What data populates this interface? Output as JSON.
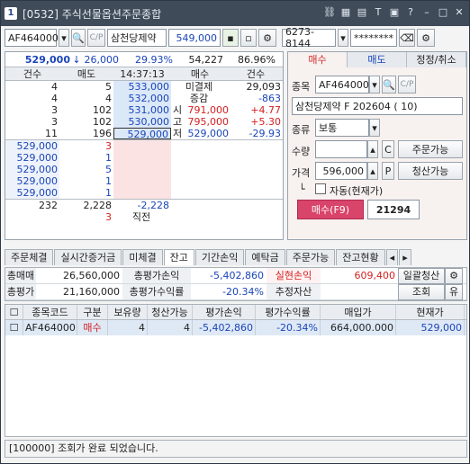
{
  "title": {
    "num": "1",
    "text": "[0532] 주식선물옵션주문종합"
  },
  "titlebar_icons": [
    "chain-icon",
    "grid-icon",
    "table-icon",
    "text-icon",
    "calc-icon",
    "help-icon",
    "minimize-icon",
    "maximize-icon",
    "close-icon"
  ],
  "top": {
    "code": "AF464000",
    "name": "삼천당제약",
    "price": "549,000",
    "account": "6273-8144",
    "password": "********"
  },
  "hoga": {
    "current": "529,000",
    "change": "26,000",
    "rate": "29.93%",
    "volume": "54,227",
    "ratio": "86.96%",
    "head": [
      "건수",
      "매도",
      "14:37:13",
      "매수",
      "건수"
    ],
    "asks": [
      {
        "cnt": "4",
        "qty": "5",
        "price": "533,000",
        "label": "미결제",
        "val": "29,093"
      },
      {
        "cnt": "4",
        "qty": "4",
        "price": "532,000",
        "label": "증감",
        "val": "-863"
      },
      {
        "cnt": "3",
        "qty": "102",
        "price": "531,000",
        "label": "시",
        "val": "791,000",
        "val2": "+4.77"
      },
      {
        "cnt": "3",
        "qty": "102",
        "price": "530,000",
        "label": "고",
        "val": "795,000",
        "val2": "+5.30"
      },
      {
        "cnt": "11",
        "qty": "196",
        "price": "529,000",
        "label": "저",
        "val": "529,000",
        "val2": "-29.93"
      }
    ],
    "bids": [
      {
        "price": "529,000",
        "qty": "3"
      },
      {
        "price": "529,000",
        "qty": "1"
      },
      {
        "price": "529,000",
        "qty": "5"
      },
      {
        "price": "529,000",
        "qty": "1"
      },
      {
        "price": "529,000",
        "qty": "1"
      }
    ],
    "total_ask_cnt": "232",
    "total_ask_qty": "2,228",
    "total_diff": "-2,228",
    "total_bid": "3",
    "prev_label": "직전"
  },
  "order": {
    "tabs": [
      "매수",
      "매도",
      "정정/취소"
    ],
    "code_label": "종목",
    "code": "AF464000",
    "fullname": "삼천당제약 F 202604 ( 10)",
    "type_label": "종류",
    "type": "보통",
    "qty_label": "수량",
    "qty_unit": "C",
    "qty_btn": "주문가능",
    "price_label": "가격",
    "price": "596,000",
    "price_unit": "P",
    "price_btn": "청산가능",
    "auto_label": "자동(현재가)",
    "submit": "매수(F9)",
    "submit_value": "21294"
  },
  "tabs": [
    "주문체결",
    "실시간증거금",
    "미체결",
    "잔고",
    "기간손익",
    "예탁금",
    "주문가능",
    "잔고현황"
  ],
  "summary": {
    "r1": [
      {
        "label": "총매매",
        "value": "26,560,000"
      },
      {
        "label": "총평가손익",
        "value": "-5,402,860"
      },
      {
        "label": "실현손익",
        "value": "609,400"
      },
      {
        "label": "일괄청산"
      }
    ],
    "r2": [
      {
        "label": "총평가",
        "value": "21,160,000"
      },
      {
        "label": "총평가수익률",
        "value": "-20.34%"
      },
      {
        "label": "추정자산",
        "value": ""
      },
      {
        "label": "조회"
      },
      {
        "label": "유"
      }
    ]
  },
  "grid": {
    "head": [
      "종목코드",
      "구분",
      "보유량",
      "청산가능",
      "평가손익",
      "평가수익률",
      "매입가",
      "현재가"
    ],
    "rows": [
      [
        "AF464000",
        "매수",
        "4",
        "4",
        "-5,402,860",
        "-20.34%",
        "664,000.000",
        "529,000"
      ]
    ]
  },
  "status": "[100000] 조회가 완료 되었습니다."
}
